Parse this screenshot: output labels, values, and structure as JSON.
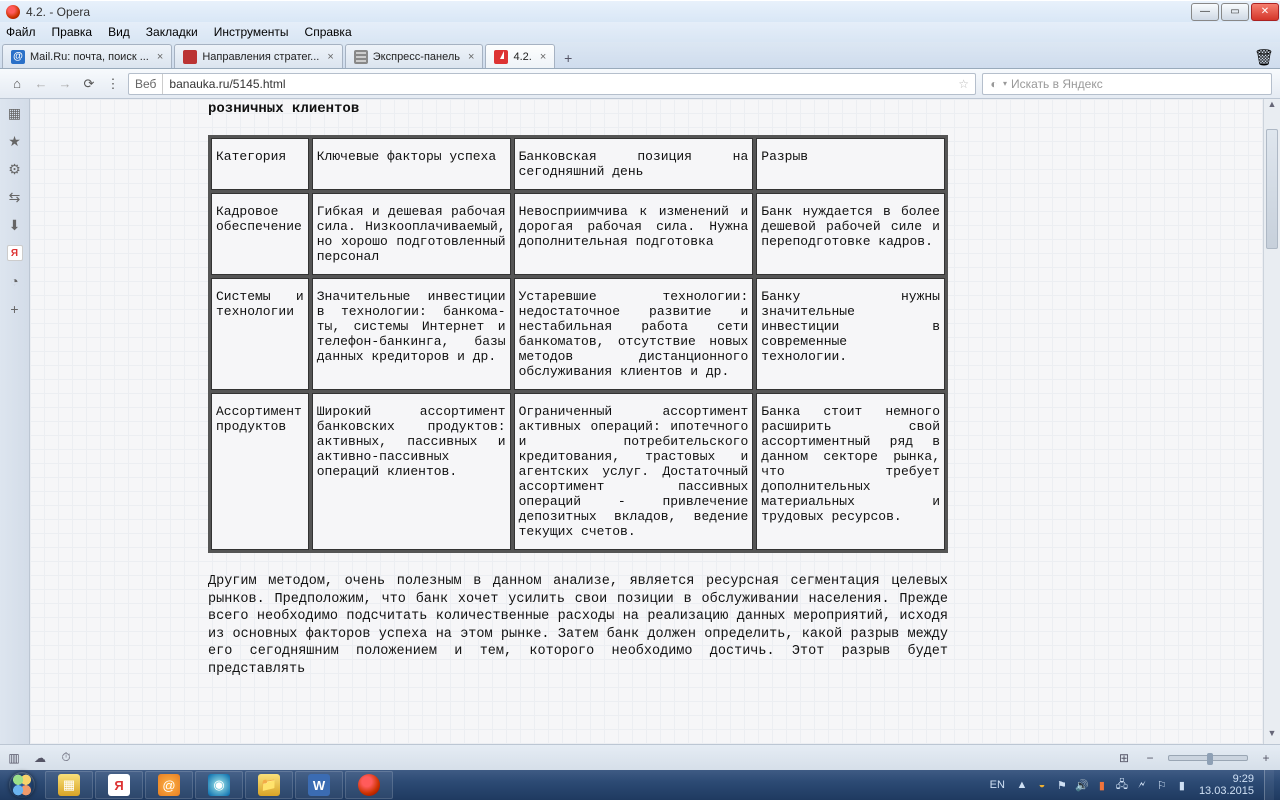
{
  "window": {
    "title": "4.2. - Opera"
  },
  "menu": [
    "Файл",
    "Правка",
    "Вид",
    "Закладки",
    "Инструменты",
    "Справка"
  ],
  "tabs": [
    {
      "label": "Mail.Ru: почта, поиск ...",
      "favicon": "m"
    },
    {
      "label": "Направления стратег...",
      "favicon": "r"
    },
    {
      "label": "Экспресс-панель",
      "favicon": "sp"
    },
    {
      "label": "4.2.",
      "favicon": "a",
      "active": true
    }
  ],
  "address": {
    "proto": "Веб",
    "url": "banauka.ru/5145.html"
  },
  "search": {
    "placeholder": "Искать в Яндекс"
  },
  "page": {
    "heading_tail": "розничных клиентов",
    "headers": {
      "c0": "Категория",
      "c1": "Ключевые факторы успеха",
      "c2": "Банковская позиция на сегодняшний день",
      "c3": "Разрыв"
    },
    "rows": [
      {
        "c0": "Кадровое обеспечение",
        "c1": "Гибкая и дешевая рабочая сила. Низкооплачиваемый, но хорошо подготовленный персонал",
        "c2": "Невосприимчива к изменений и дорогая рабочая сила. Нужна дополнительная подготовка",
        "c3": "Банк нуждается в более дешевой рабочей силе и переподготовке кадров."
      },
      {
        "c0": "Системы и технологии",
        "c1": "Значительные инвестиции в технологии: банкома-ты, системы Интернет и телефон-банкинга, базы данных кредиторов и др.",
        "c2": "Устаревшие технологии: недостаточное развитие и нестабильная работа сети банкоматов, отсутствие новых методов дистанционного обслуживания клиентов и др.",
        "c3": "Банку нужны значительные инвестиции в современные технологии."
      },
      {
        "c0": "Ассортимент продуктов",
        "c1": "Широкий ассортимент банковских продуктов: активных, пассивных и активно-пассивных операций клиентов.",
        "c2": "Ограниченный ассортимент активных операций: ипотечного и потребительского кредитования, трастовых и агентских услуг. Достаточный ассортимент пассивных операций - привлечение депозитных вкладов, ведение текущих счетов.",
        "c3": "Банка стоит немного расширить свой ассортиментный ряд в данном секторе рынка, что требует дополнительных материальных и трудовых ресурсов."
      }
    ],
    "paragraph": "Другим методом, очень полезным в данном анализе, является ресурсная сегментация целевых рынков. Предположим, что банк хочет усилить свои позиции в обслуживании населения. Прежде всего необходимо подсчитать количественные расходы на реализацию данных мероприятий, исходя из основных факторов успеха на этом рынке. Затем банк должен определить, какой разрыв между его сегодняшним положением и тем, которого необходимо достичь. Этот разрыв будет представлять"
  },
  "tray": {
    "lang": "EN",
    "time": "9:29",
    "date": "13.03.2015"
  }
}
